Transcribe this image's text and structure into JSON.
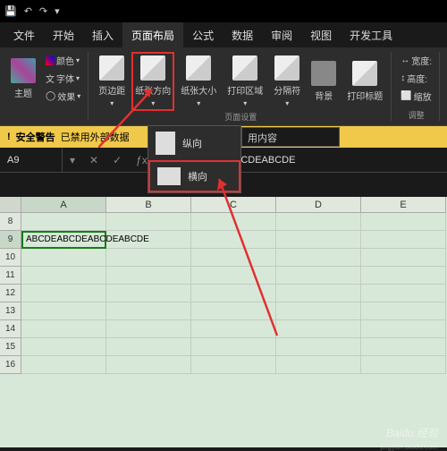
{
  "titlebar": {
    "save": "💾",
    "undo": "↶",
    "redo": "↷",
    "more": "▾"
  },
  "menu": {
    "file": "文件",
    "home": "开始",
    "insert": "插入",
    "layout": "页面布局",
    "formula": "公式",
    "data": "数据",
    "review": "审阅",
    "view": "视图",
    "dev": "开发工具"
  },
  "ribbon": {
    "theme": "主题",
    "colors": "颜色",
    "fonts": "字体",
    "effects": "效果",
    "margins": "页边距",
    "orientation": "纸张方向",
    "size": "纸张大小",
    "printarea": "打印区域",
    "breaks": "分隔符",
    "background": "背景",
    "titles": "打印标题",
    "width": "宽度:",
    "height": "高度:",
    "scale": "缩放",
    "group_pagesetup": "页面设置",
    "group_adjust": "调整"
  },
  "dropdown": {
    "portrait": "纵向",
    "landscape": "横向"
  },
  "warning": {
    "label": "安全警告",
    "text": "已禁用外部数据"
  },
  "content_label": "用内容",
  "namebox": "A9",
  "formula": "ABCDEABCDEABCDEABCDE",
  "cols": [
    "A",
    "B",
    "C",
    "D",
    "E"
  ],
  "rows": [
    "8",
    "9",
    "10",
    "11",
    "12",
    "13",
    "14",
    "15",
    "16"
  ],
  "cellA9": "ABCDEABCDEABCDEABCDE",
  "watermark": "Baidu 经验",
  "watermark_sub": "jingyan.baidu.com"
}
